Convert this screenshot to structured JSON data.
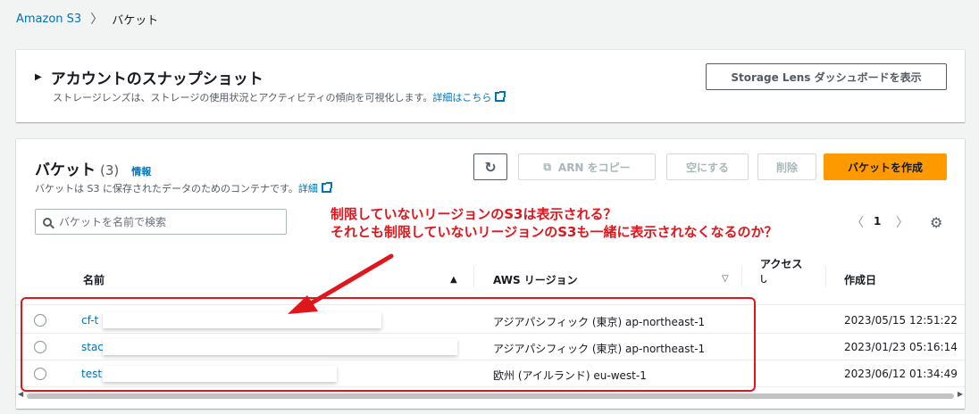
{
  "breadcrumb": {
    "root": "Amazon S3",
    "separator": "〉",
    "current": "バケット"
  },
  "snapshot": {
    "title": "アカウントのスナップショット",
    "description": "ストレージレンズは、ストレージの使用状況とアクティビティの傾向を可視化します。",
    "details_link": "詳細はこちら",
    "lens_button": "Storage Lens ダッシュボードを表示"
  },
  "buckets": {
    "title": "バケット",
    "count": "(3)",
    "info_link": "情報",
    "description": "バケットは S3 に保存されたデータのためのコンテナです。",
    "details_link": "詳細",
    "buttons": {
      "copy_arn": "ARN をコピー",
      "empty": "空にする",
      "delete": "削除",
      "create": "バケットを作成"
    },
    "search_placeholder": "バケットを名前で検索",
    "pagination": {
      "page": "1"
    },
    "columns": {
      "name": "名前",
      "region": "AWS リージョン",
      "access": "アクセス",
      "access_sub": "ᒐ",
      "created": "作成日"
    },
    "rows": [
      {
        "name": "cf-t",
        "region": "アジアパシフィック (東京) ap-northeast-1",
        "created": "2023/05/15 12:51:22"
      },
      {
        "name": "stac",
        "region": "アジアパシフィック (東京) ap-northeast-1",
        "created": "2023/01/23 05:16:14"
      },
      {
        "name": "test",
        "region": "欧州 (アイルランド) eu-west-1",
        "created": "2023/06/12 01:34:49"
      }
    ]
  },
  "annotation": {
    "line1": "制限していないリージョンのS3は表示される？",
    "line2": "それとも制限していないリージョンのS3も一緒に表示されなくなるのか？",
    "color": "#e0161d"
  },
  "colors": {
    "link": "#0073bb",
    "primary": "#ff9900"
  }
}
